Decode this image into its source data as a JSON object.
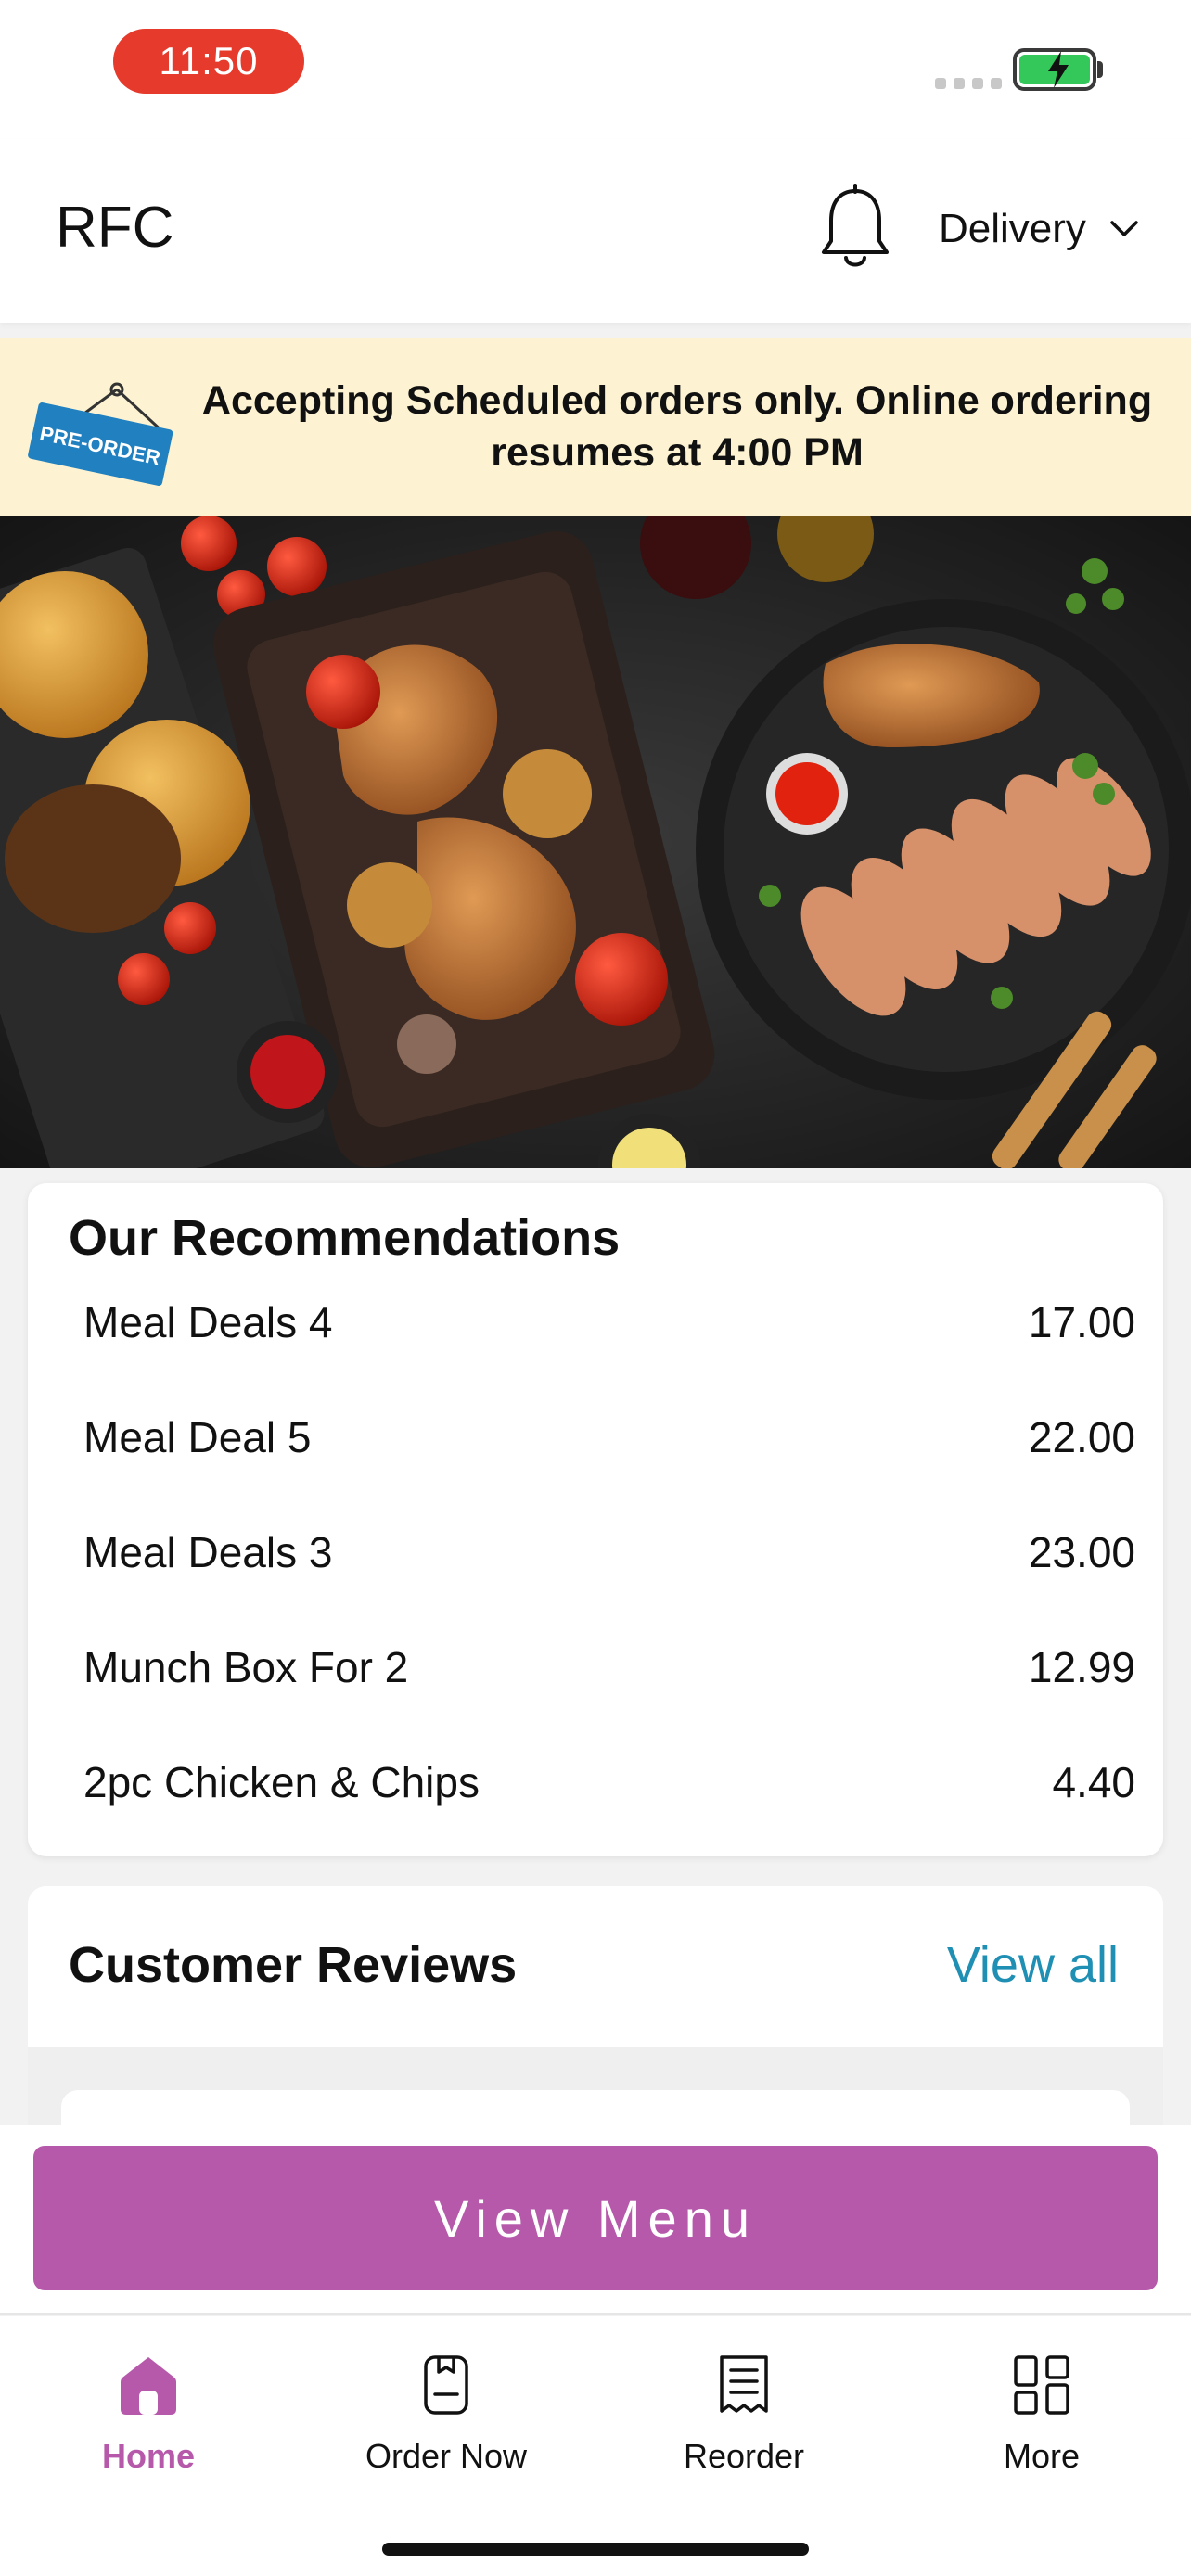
{
  "status_bar": {
    "time": "11:50"
  },
  "header": {
    "title": "RFC",
    "bell_icon": "bell-icon",
    "delivery_label": "Delivery"
  },
  "banner": {
    "tag_text": "PRE-ORDER",
    "message": "Accepting Scheduled orders only. Online ordering resumes at 4:00 PM"
  },
  "recommendations": {
    "title": "Our Recommendations",
    "items": [
      {
        "name": "Meal Deals 4",
        "price": "17.00"
      },
      {
        "name": "Meal Deal 5",
        "price": "22.00"
      },
      {
        "name": "Meal Deals 3",
        "price": "23.00"
      },
      {
        "name": "Munch Box For 2",
        "price": "12.99"
      },
      {
        "name": "2pc Chicken & Chips",
        "price": "4.40"
      }
    ]
  },
  "reviews": {
    "title": "Customer Reviews",
    "view_all": "View all"
  },
  "cta": {
    "label": "View Menu"
  },
  "tabs": [
    {
      "label": "Home",
      "icon": "home-icon",
      "active": true
    },
    {
      "label": "Order Now",
      "icon": "order-icon",
      "active": false
    },
    {
      "label": "Reorder",
      "icon": "receipt-icon",
      "active": false
    },
    {
      "label": "More",
      "icon": "grid-icon",
      "active": false
    }
  ],
  "colors": {
    "accent": "#b659aa",
    "link": "#1f8fb4",
    "banner_bg": "#fdf3d2",
    "time_pill": "#e53a2c",
    "battery": "#34c759"
  }
}
